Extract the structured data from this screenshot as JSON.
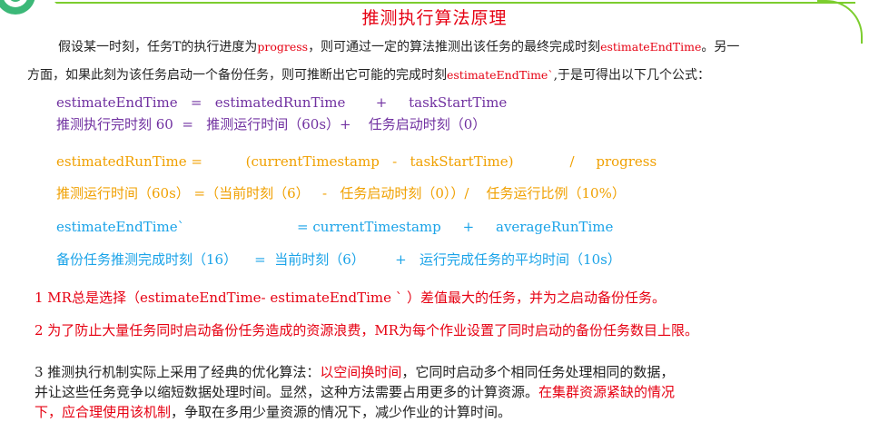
{
  "title": "推测执行算法原理",
  "intro": {
    "p1_a": "假设某一时刻，任务T的执行进度为",
    "p1_var1": "progress",
    "p1_b": "，则可通过一定的算法推测出该任务的最终完成时刻",
    "p1_var2": "estimateEndTime",
    "p1_c": "。另一",
    "p2_a": "方面，如果此刻为该任务启动一个备份任务，则可推断出它可能的完成时刻",
    "p2_var": "estimateEndTime`",
    "p2_b": ",于是可得出以下几个公式："
  },
  "formula1": {
    "line1": "estimateEndTime   =   estimatedRunTime       +     taskStartTime",
    "line2": "推测执行完时刻 60  =   推测运行时间（60s）+    任务启动时刻（0）"
  },
  "formula2": {
    "line1": "estimatedRunTime =          (currentTimestamp   -   taskStartTime)             /     progress",
    "line2": "推测运行时间（60s） =（当前时刻（6）   -   任务启动时刻（0））/    任务运行比例（10%）"
  },
  "formula3": {
    "line1": "estimateEndTime`                          = currentTimestamp     +     averageRunTime",
    "line2": "备份任务推测完成时刻（16）    =  当前时刻（6）       +   运行完成任务的平均时间（10s）"
  },
  "notes": {
    "n1": "1 MR总是选择（estimateEndTime- estimateEndTime ` ）差值最大的任务，并为之启动备份任务。",
    "n2": "2 为了防止大量任务同时启动备份任务造成的资源浪费，MR为每个作业设置了同时启动的备份任务数目上限。",
    "n3_a": "3 推测执行机制实际上采用了经典的优化算法：",
    "n3_b": "以空间换时间",
    "n3_c": "，它同时启动多个相同任务处理相同的数据，",
    "n3_d": "并让这些任务竞争以缩短数据处理时间。显然，这种方法需要占用更多的计算资源。",
    "n3_e": "在集群资源紧缺的情况",
    "n3_f": "下，应合理使用该机制",
    "n3_g": "，争取在多用少量资源的情况下，减少作业的计算时间。"
  },
  "colors": {
    "title": "#e60012",
    "formula1": "#7030a0",
    "formula2": "#f0a000",
    "formula3": "#1aa3e8",
    "highlight": "#e60012",
    "frame": "#7ccd2e"
  },
  "icons": {
    "logo": "logo-icon"
  }
}
